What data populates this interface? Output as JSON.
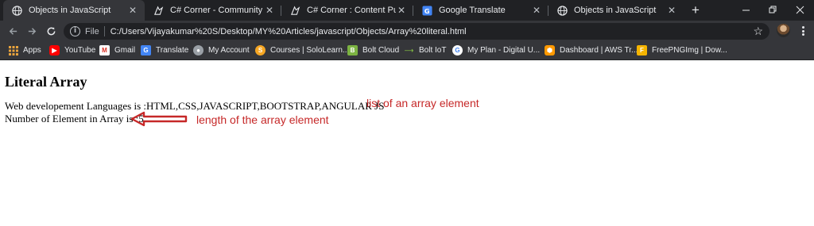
{
  "tabs": [
    {
      "title": "Objects in JavaScript",
      "icon": "globe-icon",
      "active": true
    },
    {
      "title": "C# Corner - Community of Sof",
      "icon": "csharp-corner-icon",
      "active": false
    },
    {
      "title": "C# Corner : Content Publisher",
      "icon": "csharp-corner-icon",
      "active": false
    },
    {
      "title": "Google Translate",
      "icon": "google-translate-icon",
      "active": false
    },
    {
      "title": "Objects in JavaScript",
      "icon": "globe-icon",
      "active": false
    }
  ],
  "address_bar": {
    "scheme_label": "File",
    "url": "C:/Users/Vijayakumar%20S/Desktop/MY%20Articles/javascript/Objects/Array%20literal.html"
  },
  "bookmarks": [
    {
      "label": "Apps",
      "icon": "apps-grid-icon"
    },
    {
      "label": "YouTube",
      "icon": "youtube-icon"
    },
    {
      "label": "Gmail",
      "icon": "gmail-icon"
    },
    {
      "label": "Translate",
      "icon": "google-translate-icon"
    },
    {
      "label": "My Account",
      "icon": "google-account-icon"
    },
    {
      "label": "Courses | SoloLearn...",
      "icon": "sololearn-icon"
    },
    {
      "label": "Bolt Cloud",
      "icon": "bolt-cloud-icon"
    },
    {
      "label": "Bolt IoT",
      "icon": "bolt-iot-icon"
    },
    {
      "label": "My Plan - Digital U...",
      "icon": "google-icon"
    },
    {
      "label": "Dashboard | AWS Tr...",
      "icon": "aws-icon"
    },
    {
      "label": "FreePNGImg | Dow...",
      "icon": "freepngimg-icon"
    }
  ],
  "page": {
    "heading": "Literal Array",
    "line1": "Web developement Languages is :HTML,CSS,JAVASCRIPT,BOOTSTRAP,ANGULAR JS",
    "line2": "Number of Element in Array is :5",
    "annotation1": "list of an array element",
    "annotation2": "length of the array element"
  },
  "colors": {
    "annotation": "#c62828",
    "tab_strip": "#202124",
    "toolbar": "#35363a"
  }
}
